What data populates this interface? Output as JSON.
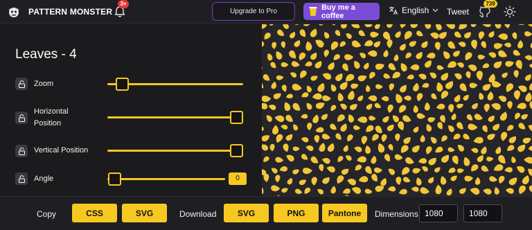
{
  "header": {
    "brand": "PATTERN MONSTER",
    "notifications_badge": "3+",
    "upgrade_label": "Upgrade to Pro",
    "coffee_label": "Buy me a coffee",
    "language": "English",
    "tweet_label": "Tweet",
    "github_stars": "739"
  },
  "panel": {
    "title": "Leaves - 4",
    "controls": [
      {
        "label": "Zoom",
        "value_fraction": 0.11
      },
      {
        "label_line1": "Horizontal",
        "label_line2": "Position",
        "value_fraction": 1.0
      },
      {
        "label": "Vertical Position",
        "value_fraction": 1.0
      },
      {
        "label": "Angle",
        "value_fraction": 0.0,
        "value": "0"
      }
    ]
  },
  "preview": {
    "background_color": "#25252a",
    "leaf_color": "#f2c638"
  },
  "bottom": {
    "copy_label": "Copy",
    "copy_css": "CSS",
    "copy_svg": "SVG",
    "download_label": "Download",
    "download_svg": "SVG",
    "download_png": "PNG",
    "download_pantone": "Pantone",
    "dimensions_label": "Dimensions",
    "width": "1080",
    "height": "1080"
  },
  "colors": {
    "accent": "#f7c821",
    "purple": "#7b4dd6",
    "badge_red": "#e23b3b"
  }
}
